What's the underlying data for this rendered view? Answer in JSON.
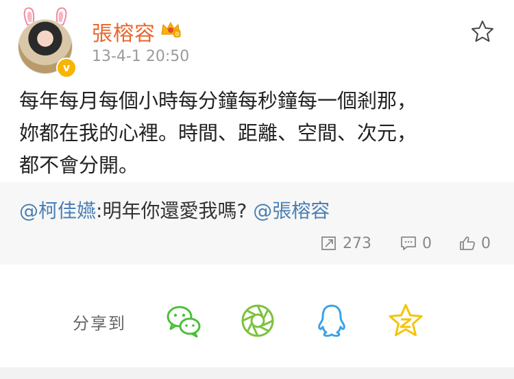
{
  "post": {
    "author": "張榕容",
    "time": "13-4-1 20:50",
    "text": "每年每月每個小時每分鐘每秒鐘每一個剎那，\n妳都在我的心裡。時間、距離、空間、次元，\n都不會分開。"
  },
  "mention": {
    "user": "@柯佳嬿",
    "separator": ":",
    "message": "明年你還愛我嗎?",
    "mentioned": "@張榕容"
  },
  "stats": {
    "reposts": "273",
    "comments": "0",
    "likes": "0"
  },
  "share": {
    "label": "分享到",
    "targets": [
      "wechat-icon",
      "moments-icon",
      "qq-icon",
      "qzone-icon"
    ]
  },
  "colors": {
    "author": "#e8662b",
    "link": "#4a7fb5",
    "wechat": "#4cbf3a",
    "moments": "#7cc23d",
    "qq": "#3aa0e8",
    "qzone": "#f5c400"
  }
}
